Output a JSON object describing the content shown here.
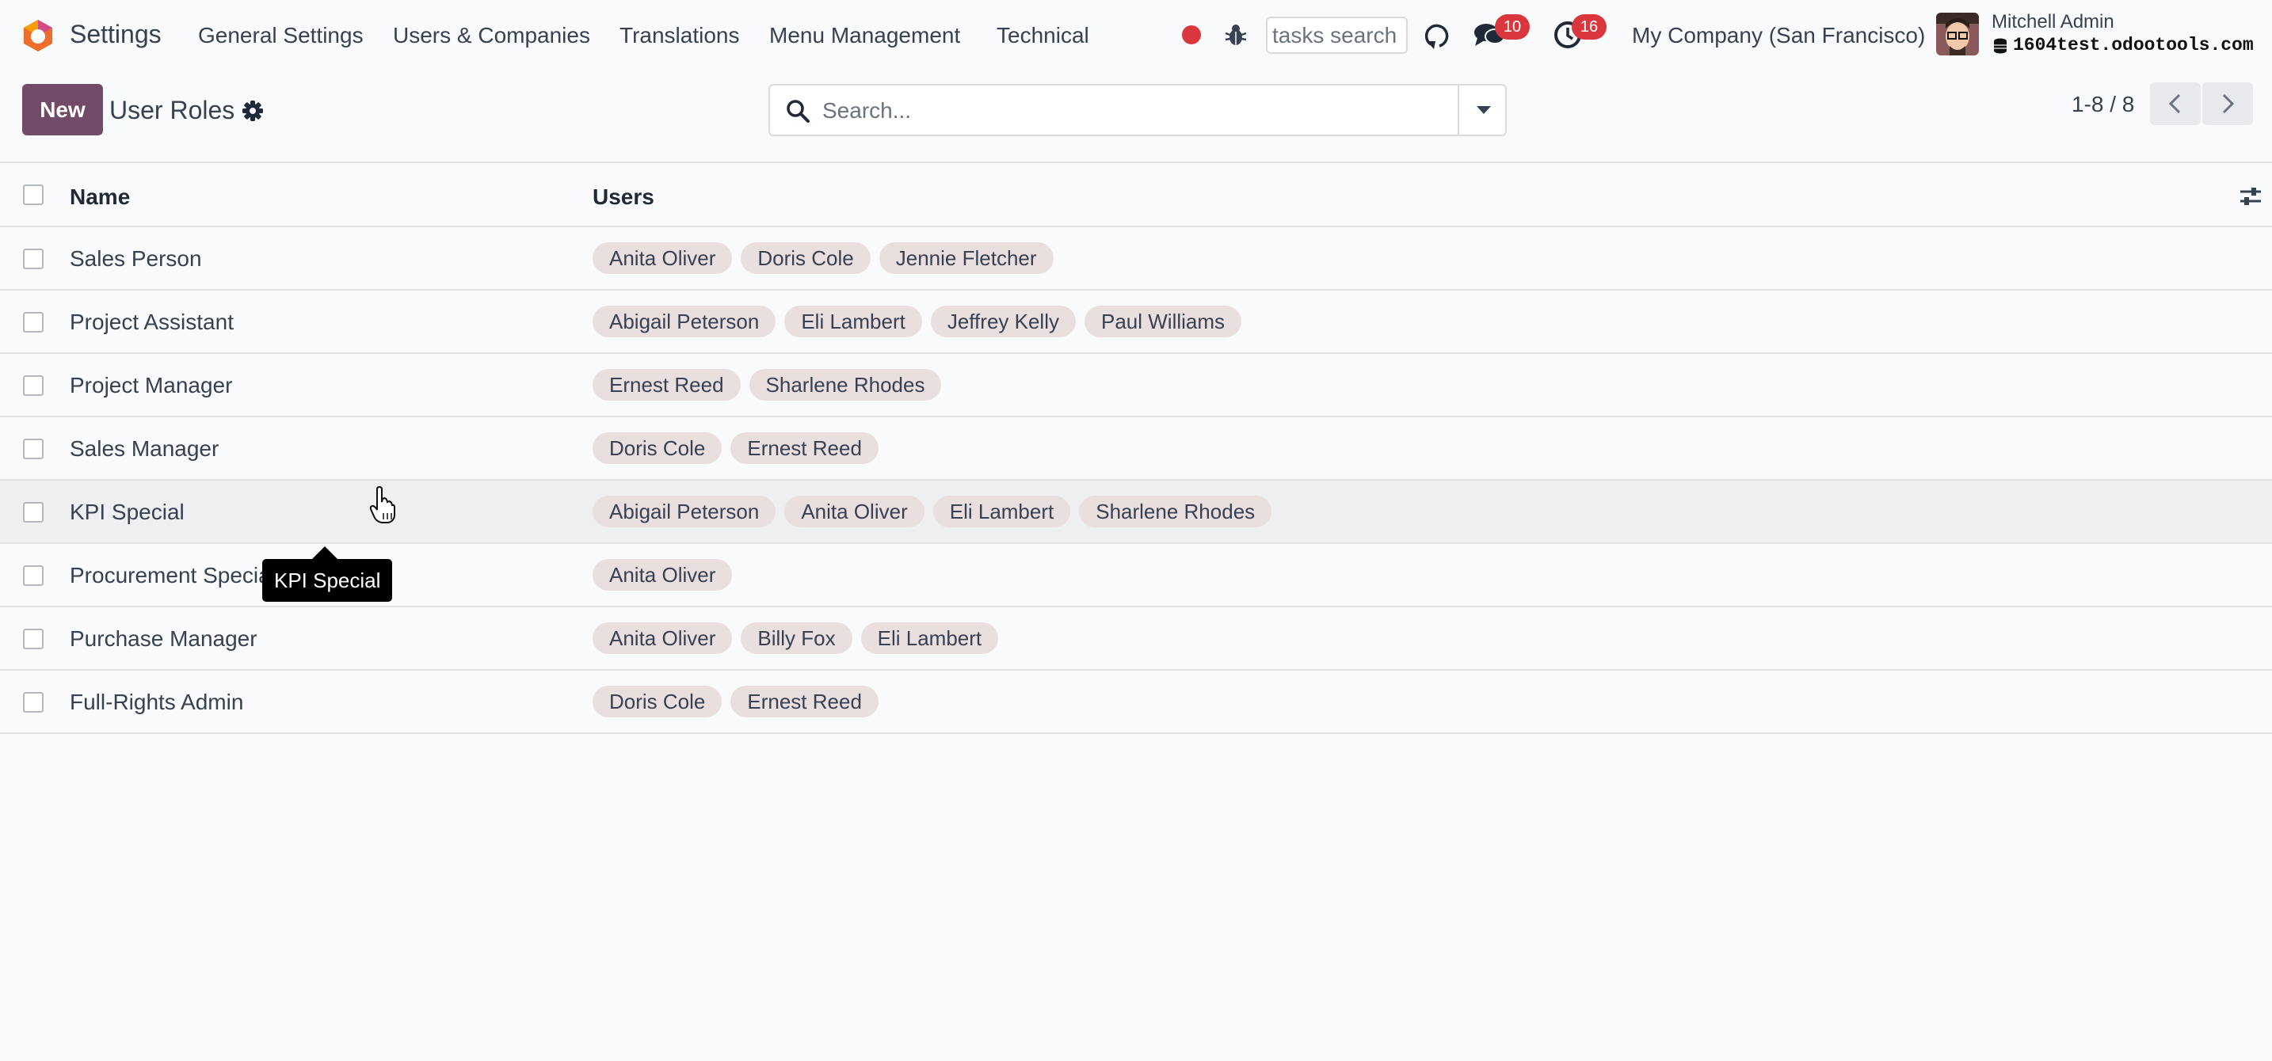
{
  "navbar": {
    "app_name": "Settings",
    "menu": [
      "General Settings",
      "Users & Companies",
      "Translations",
      "Menu Management",
      "Technical"
    ],
    "tasks_search_placeholder": "tasks search",
    "messages_count": "10",
    "activities_count": "16",
    "company": "My Company (San Francisco)",
    "user_name": "Mitchell Admin",
    "database": "1604test.odootools.com"
  },
  "control_panel": {
    "new_label": "New",
    "title": "User Roles",
    "search_placeholder": "Search...",
    "pager": "1-8 / 8"
  },
  "list": {
    "columns": [
      "Name",
      "Users"
    ],
    "rows": [
      {
        "name": "Sales Person",
        "users": [
          "Anita Oliver",
          "Doris Cole",
          "Jennie Fletcher"
        ]
      },
      {
        "name": "Project Assistant",
        "users": [
          "Abigail Peterson",
          "Eli Lambert",
          "Jeffrey Kelly",
          "Paul Williams"
        ]
      },
      {
        "name": "Project Manager",
        "users": [
          "Ernest Reed",
          "Sharlene Rhodes"
        ]
      },
      {
        "name": "Sales Manager",
        "users": [
          "Doris Cole",
          "Ernest Reed"
        ]
      },
      {
        "name": "KPI Special",
        "users": [
          "Abigail Peterson",
          "Anita Oliver",
          "Eli Lambert",
          "Sharlene Rhodes"
        ]
      },
      {
        "name": "Procurement Special",
        "users": [
          "Anita Oliver"
        ]
      },
      {
        "name": "Purchase Manager",
        "users": [
          "Anita Oliver",
          "Billy Fox",
          "Eli Lambert"
        ]
      },
      {
        "name": "Full-Rights Admin",
        "users": [
          "Doris Cole",
          "Ernest Reed"
        ]
      }
    ]
  },
  "tooltip": "KPI Special",
  "colors": {
    "primary": "#714b67",
    "badge": "#d9363e",
    "tag_bg": "#e9dfdf"
  }
}
